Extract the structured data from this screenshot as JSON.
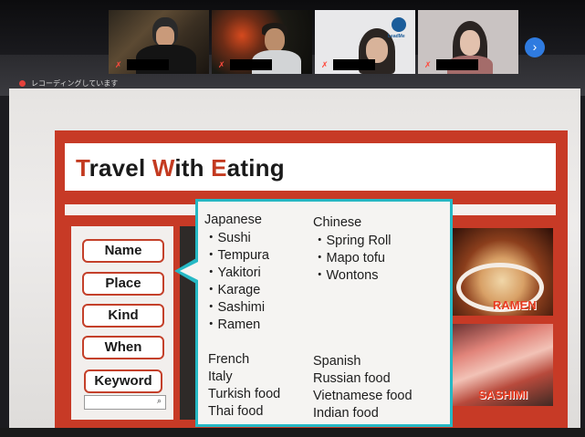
{
  "recording": {
    "text": "レコーディングしています"
  },
  "participants": [
    {
      "name_hidden": true
    },
    {
      "name_hidden": true
    },
    {
      "name_hidden": true,
      "logo_text": "LeadMe"
    },
    {
      "name_hidden": true
    }
  ],
  "navigation": {
    "next_icon": "chevron-right-icon",
    "next_glyph": "›"
  },
  "slide": {
    "title_parts": [
      {
        "cap": "T",
        "rest": "ravel "
      },
      {
        "cap": "W",
        "rest": "ith "
      },
      {
        "cap": "E",
        "rest": "ating"
      }
    ],
    "menu": [
      "Name",
      "Place",
      "Kind",
      "When",
      "Keyword"
    ],
    "search_icon": "⌕",
    "popup": {
      "japanese": {
        "header": "Japanese",
        "items": [
          "・Sushi",
          "・Tempura",
          "・Yakitori",
          "・Karage",
          "・Sashimi",
          "・Ramen"
        ]
      },
      "chinese": {
        "header": "Chinese",
        "items": [
          "・Spring Roll",
          "・Mapo tofu",
          "・Wontons"
        ]
      },
      "left_list": [
        "French",
        "Italy",
        "Turkish food",
        "Thai food"
      ],
      "right_list": [
        "Spanish",
        "Russian food",
        "Vietnamese food",
        "Indian food"
      ]
    },
    "food_images": {
      "ramen_label": "RAMEN",
      "sashimi_label": "SASHIMI"
    }
  },
  "colors": {
    "brand_red": "#c73a26",
    "popup_border": "#25b8c4",
    "next_button": "#2f7be0",
    "record_dot": "#e5413b"
  }
}
